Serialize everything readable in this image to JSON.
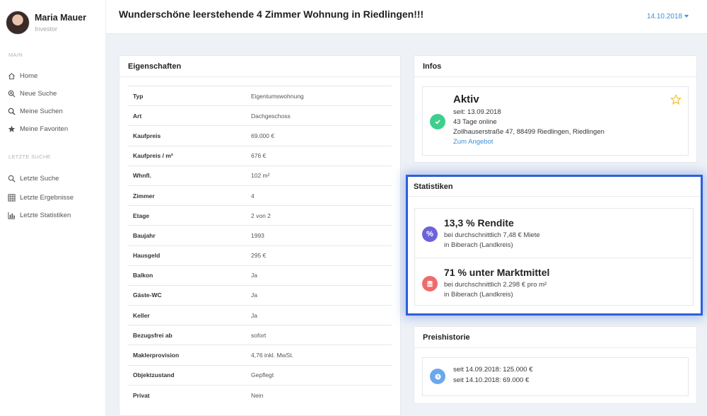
{
  "user": {
    "name": "Maria Mauer",
    "role": "Investor"
  },
  "sidebar": {
    "section_main": "MAIN",
    "main_items": [
      {
        "label": "Home",
        "icon": "home-icon"
      },
      {
        "label": "Neue Suche",
        "icon": "search-plus-icon"
      },
      {
        "label": "Meine Suchen",
        "icon": "search-icon"
      },
      {
        "label": "Meine Favoriten",
        "icon": "star-icon"
      }
    ],
    "section_recent": "LETZTE SUCHE",
    "recent_items": [
      {
        "label": "Letzte Suche",
        "icon": "search-icon"
      },
      {
        "label": "Letzte Ergebnisse",
        "icon": "grid-icon"
      },
      {
        "label": "Letzte Statistiken",
        "icon": "bar-chart-icon"
      }
    ]
  },
  "header": {
    "title": "Wunderschöne leerstehende 4 Zimmer Wohnung in Riedlingen!!!",
    "date": "14.10.2018"
  },
  "properties": {
    "title": "Eigenschaften",
    "rows": [
      {
        "key": "Typ",
        "value": "Eigentumswohnung"
      },
      {
        "key": "Art",
        "value": "Dachgeschoss"
      },
      {
        "key": "Kaufpreis",
        "value": "69.000 €"
      },
      {
        "key": "Kaufpreis / m²",
        "value": "676 €"
      },
      {
        "key": "Whnfl.",
        "value": "102 m²"
      },
      {
        "key": "Zimmer",
        "value": "4"
      },
      {
        "key": "Etage",
        "value": "2 von 2"
      },
      {
        "key": "Baujahr",
        "value": "1993"
      },
      {
        "key": "Hausgeld",
        "value": "295 €"
      },
      {
        "key": "Balkon",
        "value": "Ja"
      },
      {
        "key": "Gäste-WC",
        "value": "Ja"
      },
      {
        "key": "Keller",
        "value": "Ja"
      },
      {
        "key": "Bezugsfrei ab",
        "value": "sofort"
      },
      {
        "key": "Maklerprovision",
        "value": "4,76 inkl. MwSt."
      },
      {
        "key": "Objektzustand",
        "value": "Gepflegt"
      },
      {
        "key": "Privat",
        "value": "Nein"
      }
    ]
  },
  "infos": {
    "title": "Infos",
    "status": "Aktiv",
    "since": "seit: 13.09.2018",
    "online": "43 Tage online",
    "address": "Zollhauserstraße 47, 88499 Riedlingen, Riedlingen",
    "link": "Zum Angebot",
    "status_color": "#3ecf8e"
  },
  "stats": {
    "title": "Statistiken",
    "items": [
      {
        "title": "13,3 % Rendite",
        "line1": "bei durchschnittlich 7,48 € Miete",
        "line2": "in Biberach (Landkreis)",
        "icon": "%",
        "color": "#6c63d9"
      },
      {
        "title": "71 % unter Marktmittel",
        "line1": "bei durchschnittlich 2.298 € pro m²",
        "line2": "in Biberach (Landkreis)",
        "icon": "coins",
        "color": "#ef6b6b"
      }
    ]
  },
  "history": {
    "title": "Preishistorie",
    "lines": [
      "seit 14.09.2018: 125.000 €",
      "seit 14.10.2018: 69.000 €"
    ]
  }
}
